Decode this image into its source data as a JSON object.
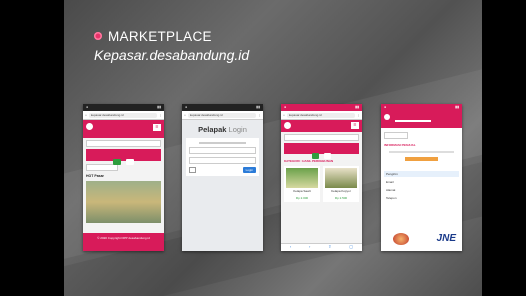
{
  "heading": "MARKETPLACE",
  "subtitle": "Kepasar.desabandung.id",
  "phone1": {
    "url": "kepasar.desabandung.id",
    "section": "HOT Pasar",
    "footer": "© 2020 Copyright DPP desabandung.id"
  },
  "phone2": {
    "url": "kepasar.desabandung.id",
    "title_a": "Pelapak",
    "title_b": "Login",
    "submit": "Login"
  },
  "phone3": {
    "url": "kepasar.desabandung.id",
    "section": "KATEGORI : HASIL PERKEBUNAN",
    "products": [
      {
        "name": "Kelapa Sawit",
        "price": "Rp 2.000"
      },
      {
        "name": "Kelapa Kopyor",
        "price": "Rp 2.500"
      }
    ]
  },
  "phone4": {
    "section": "INFORMASI PENJUAL",
    "field_labels": [
      "Pengirim",
      "Email",
      "Alamat",
      "Telepon"
    ],
    "courier": "JNE"
  }
}
